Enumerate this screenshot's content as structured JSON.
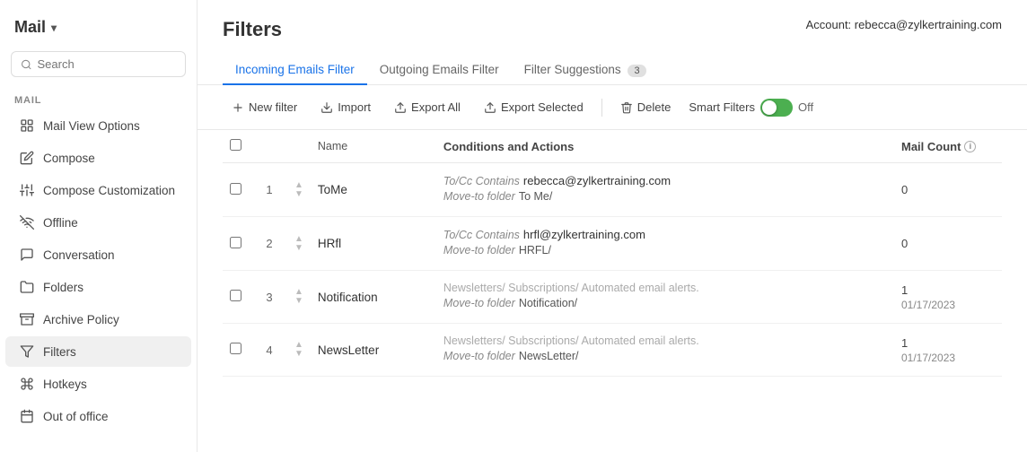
{
  "app": {
    "title": "Mail",
    "chevron": "▾"
  },
  "account": {
    "label": "Account:",
    "email": "rebecca@zylkertraining.com"
  },
  "search": {
    "placeholder": "Search"
  },
  "sidebar_section": "MAIL",
  "sidebar": {
    "items": [
      {
        "id": "mail-view-options",
        "label": "Mail View Options",
        "icon": "grid"
      },
      {
        "id": "compose",
        "label": "Compose",
        "icon": "edit"
      },
      {
        "id": "compose-customization",
        "label": "Compose Customization",
        "icon": "sliders"
      },
      {
        "id": "offline",
        "label": "Offline",
        "icon": "wifi-off"
      },
      {
        "id": "conversation",
        "label": "Conversation",
        "icon": "message-square"
      },
      {
        "id": "folders",
        "label": "Folders",
        "icon": "folder"
      },
      {
        "id": "archive-policy",
        "label": "Archive Policy",
        "icon": "archive"
      },
      {
        "id": "filters",
        "label": "Filters",
        "icon": "filter",
        "active": true
      },
      {
        "id": "hotkeys",
        "label": "Hotkeys",
        "icon": "command"
      },
      {
        "id": "out-of-office",
        "label": "Out of office",
        "icon": "calendar"
      }
    ]
  },
  "page_title": "Filters",
  "tabs": [
    {
      "id": "incoming",
      "label": "Incoming Emails Filter",
      "active": true
    },
    {
      "id": "outgoing",
      "label": "Outgoing Emails Filter",
      "active": false
    },
    {
      "id": "suggestions",
      "label": "Filter Suggestions",
      "badge": "3",
      "active": false
    }
  ],
  "toolbar": {
    "new_filter": "New filter",
    "import": "Import",
    "export_all": "Export All",
    "export_selected": "Export Selected",
    "delete": "Delete",
    "smart_filters": "Smart Filters",
    "off_label": "Off"
  },
  "table": {
    "headers": [
      {
        "id": "check",
        "label": ""
      },
      {
        "id": "num",
        "label": ""
      },
      {
        "id": "arrows",
        "label": ""
      },
      {
        "id": "name",
        "label": "Name"
      },
      {
        "id": "conditions",
        "label": "Conditions and Actions"
      },
      {
        "id": "count",
        "label": "Mail Count"
      }
    ],
    "rows": [
      {
        "num": "1",
        "name": "ToMe",
        "cond_label": "To/Cc Contains",
        "cond_value": "rebecca@zylkertraining.com",
        "move_label": "Move-to folder",
        "move_value": "To Me/",
        "count": "0",
        "date": "",
        "dim": false
      },
      {
        "num": "2",
        "name": "HRfl",
        "cond_label": "To/Cc Contains",
        "cond_value": "hrfl@zylkertraining.com",
        "move_label": "Move-to folder",
        "move_value": "HRFL/",
        "count": "0",
        "date": "",
        "dim": false
      },
      {
        "num": "3",
        "name": "Notification",
        "cond_label": "Newsletters/ Subscriptions/ Automated email alerts.",
        "cond_value": "",
        "move_label": "Move-to folder",
        "move_value": "Notification/",
        "count": "1",
        "date": "01/17/2023",
        "dim": true
      },
      {
        "num": "4",
        "name": "NewsLetter",
        "cond_label": "Newsletters/ Subscriptions/ Automated email alerts.",
        "cond_value": "",
        "move_label": "Move-to folder",
        "move_value": "NewsLetter/",
        "count": "1",
        "date": "01/17/2023",
        "dim": true
      }
    ]
  }
}
